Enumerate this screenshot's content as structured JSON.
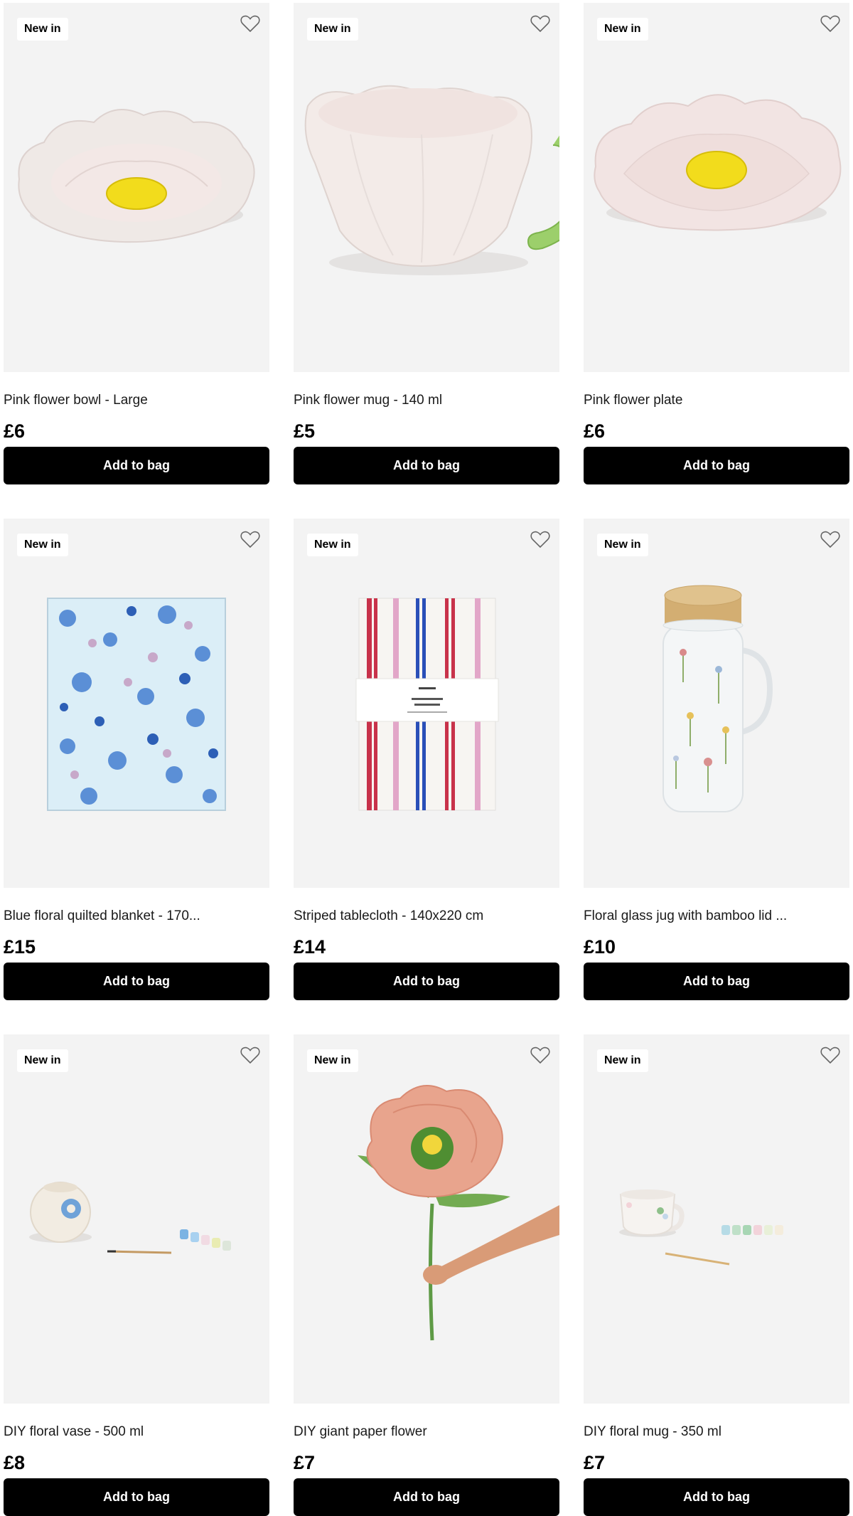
{
  "products": [
    {
      "badge": "New in",
      "name": "Pink flower bowl - Large",
      "price": "£6",
      "button": "Add to bag",
      "image": "pink-flower-bowl"
    },
    {
      "badge": "New in",
      "name": "Pink flower mug - 140 ml",
      "price": "£5",
      "button": "Add to bag",
      "image": "pink-flower-mug"
    },
    {
      "badge": "New in",
      "name": "Pink flower plate",
      "price": "£6",
      "button": "Add to bag",
      "image": "pink-flower-plate"
    },
    {
      "badge": "New in",
      "name": "Blue floral quilted blanket - 170...",
      "price": "£15",
      "button": "Add to bag",
      "image": "blue-floral-blanket"
    },
    {
      "badge": "New in",
      "name": "Striped tablecloth - 140x220 cm",
      "price": "£14",
      "button": "Add to bag",
      "image": "striped-tablecloth"
    },
    {
      "badge": "New in",
      "name": "Floral glass jug with bamboo lid ...",
      "price": "£10",
      "button": "Add to bag",
      "image": "floral-glass-jug"
    },
    {
      "badge": "New in",
      "name": "DIY floral vase - 500 ml",
      "price": "£8",
      "button": "Add to bag",
      "image": "diy-floral-vase"
    },
    {
      "badge": "New in",
      "name": "DIY giant paper flower",
      "price": "£7",
      "button": "Add to bag",
      "image": "diy-paper-flower"
    },
    {
      "badge": "New in",
      "name": "DIY floral mug - 350 ml",
      "price": "£7",
      "button": "Add to bag",
      "image": "diy-floral-mug"
    }
  ],
  "colors": {
    "button_bg": "#000000",
    "button_text": "#ffffff",
    "card_bg": "#f3f3f3"
  },
  "icons": {
    "wishlist": "heart-outline-icon"
  }
}
